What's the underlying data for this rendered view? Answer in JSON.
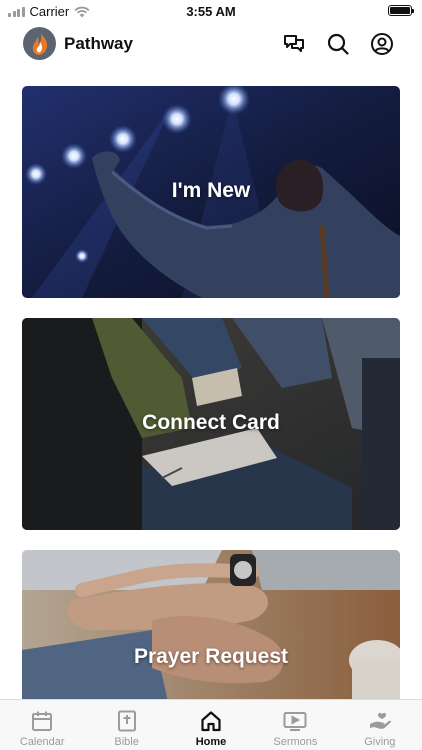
{
  "status_bar": {
    "carrier": "Carrier",
    "time": "3:55 AM"
  },
  "header": {
    "title": "Pathway"
  },
  "cards": [
    {
      "label": "I'm New"
    },
    {
      "label": "Connect Card"
    },
    {
      "label": "Prayer Request"
    }
  ],
  "tabs": [
    {
      "label": "Calendar",
      "icon": "calendar-icon"
    },
    {
      "label": "Bible",
      "icon": "bible-icon"
    },
    {
      "label": "Home",
      "icon": "home-icon",
      "active": true
    },
    {
      "label": "Sermons",
      "icon": "sermons-icon"
    },
    {
      "label": "Giving",
      "icon": "giving-icon"
    }
  ],
  "colors": {
    "active_tab": "#111111",
    "inactive_tab": "#9b9b9b",
    "logo_bg": "#5b6470",
    "logo_flame": "#e8792b"
  }
}
